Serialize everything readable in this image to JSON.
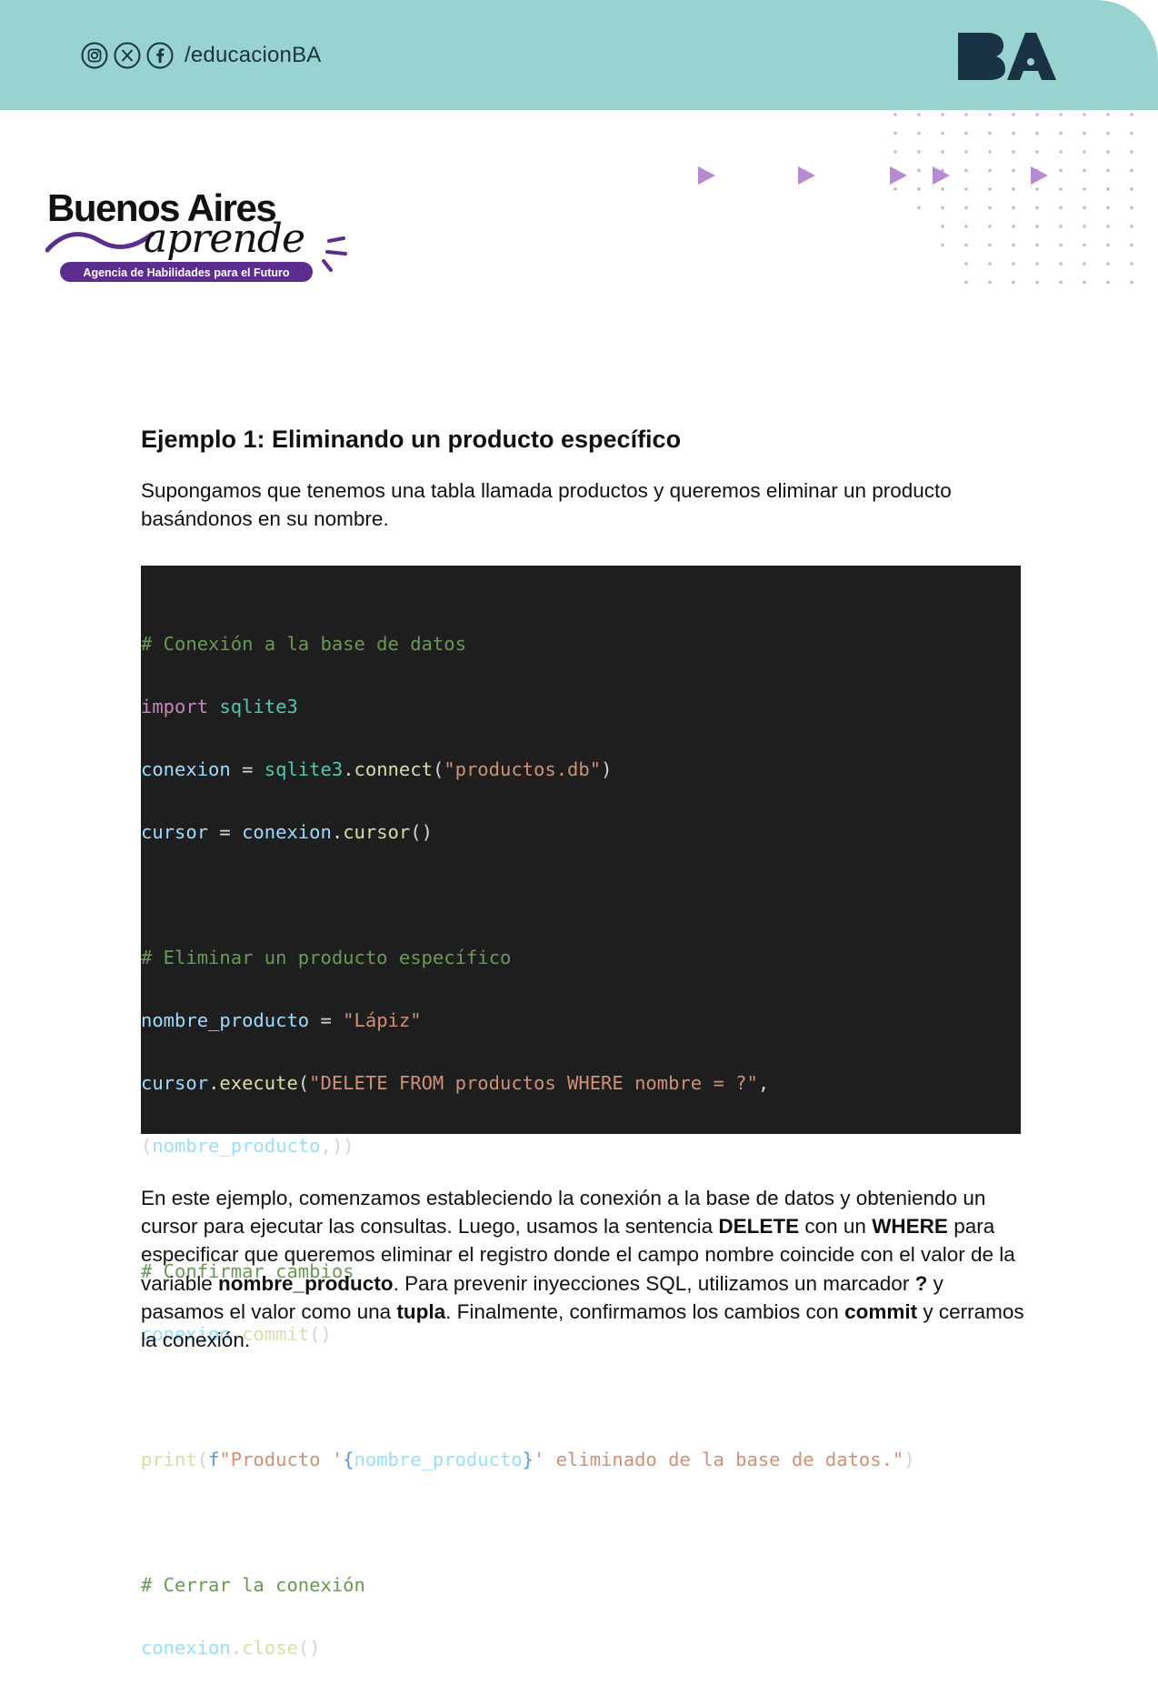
{
  "header": {
    "handle": "/educacionBA",
    "social_icons": [
      "instagram-icon",
      "x-icon",
      "facebook-icon"
    ],
    "logo_text": "BA",
    "bg_color": "#98d3cf"
  },
  "brand": {
    "line1": "Buenos Aires",
    "line2": "aprende",
    "tagline": "Agencia de Habilidades para el Futuro",
    "accent_color": "#5b2d8e"
  },
  "section": {
    "title": "Ejemplo 1: Eliminando un producto específico",
    "intro": "Supongamos que tenemos una tabla llamada productos y queremos eliminar un producto basándonos en su nombre."
  },
  "code": {
    "comment_connect": "# Conexión a la base de datos",
    "kw_import": "import",
    "mod_sqlite": "sqlite3",
    "var_conexion": "conexion",
    "var_cursor": "cursor",
    "eq": " = ",
    "fn_connect": "connect",
    "str_db": "\"productos.db\"",
    "fn_cursor": "cursor",
    "comment_delete": "# Eliminar un producto específico",
    "var_nombre": "nombre_producto",
    "str_lapiz": "\"Lápiz\"",
    "fn_execute": "execute",
    "str_sql": "\"DELETE FROM productos WHERE nombre = ?\"",
    "comment_commit": "# Confirmar cambios",
    "fn_commit": "commit",
    "fn_print": "print",
    "fstr_prefix": "f",
    "fstr_part1": "\"Producto '",
    "fstr_part2": "' eliminado de la base de datos.\"",
    "comment_close": "# Cerrar la conexión",
    "fn_close": "close"
  },
  "explanation": {
    "p1": "En este ejemplo, comenzamos estableciendo la conexión a la base de datos y obteniendo un cursor para ejecutar las consultas. Luego, usamos la sentencia ",
    "b1": "DELETE",
    "p2": " con un ",
    "b2": "WHERE",
    "p3": " para especificar que queremos eliminar el registro donde el campo nombre coincide con el valor de la variable ",
    "b3": "nombre_producto",
    "p4": ". Para prevenir inyecciones SQL, utilizamos un marcador ",
    "b4": "?",
    "p5": " y pasamos el valor como una ",
    "b5": "tupla",
    "p6": ". Finalmente, confirmamos los cambios con ",
    "b6": "commit",
    "p7": " y cerramos la conexión."
  }
}
